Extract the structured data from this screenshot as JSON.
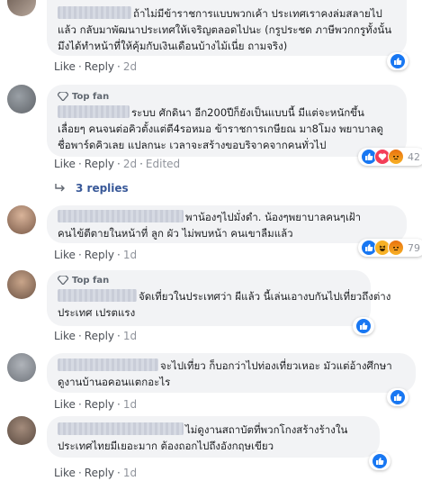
{
  "topfan_label": "Top fan",
  "comments": [
    {
      "lines": [
        "ถ้าไม่มีข้าราชการแบบพวกเค้า ประเทศเราคงล่มสลายไป",
        "แล้ว กลับมาพัฒนาประเทศให้เจริญตลอดไปนะ (กรูประชด ภาษีพวกกรูทั้งนั้น",
        "มึงได้ทำหน้าที่ให้คุ้มกับเงินเดือนบ้างไม้เนี่ย ถามจริง)"
      ],
      "like": "Like",
      "reply": "Reply",
      "time": "2d",
      "reactions": [
        "like"
      ],
      "count": ""
    },
    {
      "topfan": true,
      "lines": [
        "ระบบ ศักดินา อีก200ปีก็ยังเป็นแบบนี้ มีแต่จะหนักขึ้น",
        "เลื่อยๆ คนจนต่อคิวตั้งแต่ตี4รอหมอ ข้าราชการเกษียณ มา8โมง พยาบาลดู",
        "ชื่อพาร์ดคิวเลย แปลกนะ เวลาจะสร้างขอบริจาคจากคนทั่วไป"
      ],
      "like": "Like",
      "reply": "Reply",
      "time": "2d",
      "edited": "Edited",
      "reactions": [
        "like",
        "love",
        "angry"
      ],
      "count": "42",
      "replies_label": "3 replies"
    },
    {
      "lines": [
        "พาน้องๆไปมั่งดำ. น้องๆพยาบาลคนๆเฝ้า",
        "คนไข้ตีตายในหน้าที่ ลูก ผัว ไม่พบหน้า คนเขาลืมแล้ว"
      ],
      "like": "Like",
      "reply": "Reply",
      "time": "1d",
      "reactions": [
        "like",
        "haha",
        "angry"
      ],
      "count": "79"
    },
    {
      "topfan": true,
      "lines": [
        "จัดเที่ยวในประเทศว่า ผีแล้ว นี้เล่นเอางบกันไปเที่ยวถึงต่าง",
        "ประเทศ เปรตแรง"
      ],
      "like": "Like",
      "reply": "Reply",
      "time": "1d",
      "reactions": [
        "like"
      ],
      "count": ""
    },
    {
      "lines": [
        "จะไปเที่ยว ก็บอกว่าไปท่องเที่ยวเหอะ มัวแต่อ้างศึกษา",
        "ดูงานบ้านอคอนแตกอะไร"
      ],
      "like": "Like",
      "reply": "Reply",
      "time": "1d",
      "reactions": [
        "like"
      ],
      "count": ""
    },
    {
      "lines": [
        "ไม่ดูงานสถาบัตที่พวกโกงสร้างร้างใน",
        "ประเทศไทยมีเยอะมาก ต้องถอกไปถึงอังกฤษเขียว"
      ],
      "like": "Like",
      "reply": "Reply",
      "time": "1d",
      "reactions": [
        "like"
      ],
      "count": ""
    }
  ]
}
